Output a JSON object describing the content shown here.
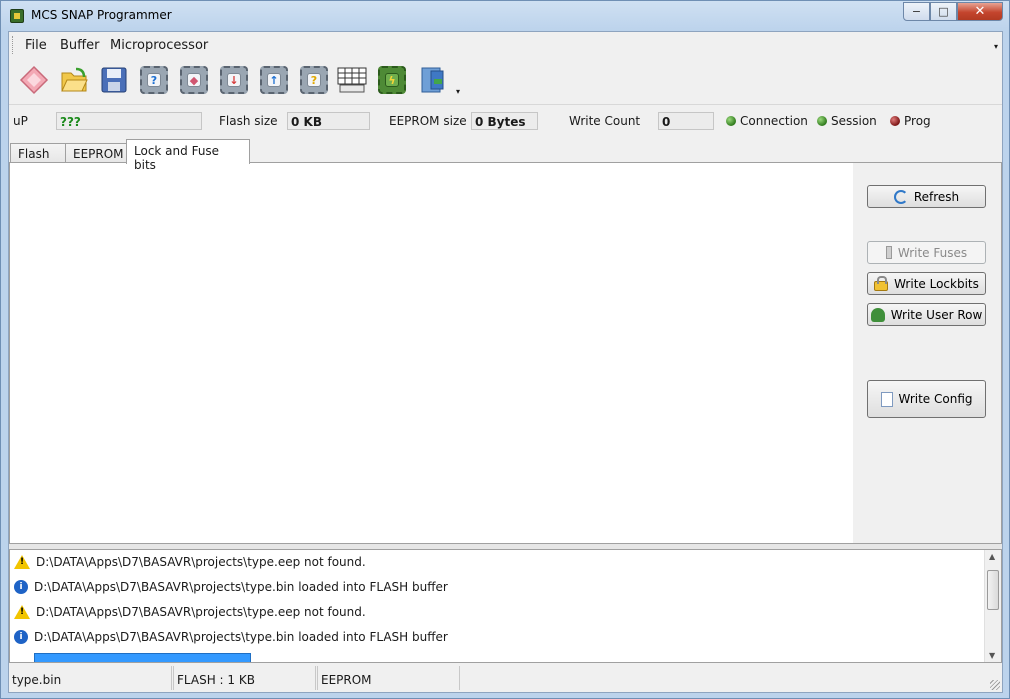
{
  "window": {
    "title": "MCS SNAP Programmer",
    "minimize": "−",
    "maximize": "□",
    "close": "✕"
  },
  "menu": {
    "items": [
      "File",
      "Buffer",
      "Microprocessor"
    ],
    "overflow": "▾"
  },
  "toolbar": {
    "buttons": [
      {
        "name": "erase-chip-icon"
      },
      {
        "name": "open-folder-icon"
      },
      {
        "name": "save-disk-icon"
      },
      {
        "name": "identify-chip-icon",
        "glyph": "?"
      },
      {
        "name": "erase-chip-pink-icon",
        "glyph": "◆"
      },
      {
        "name": "write-chip-icon",
        "glyph": "↓"
      },
      {
        "name": "read-chip-icon",
        "glyph": "↑"
      },
      {
        "name": "verify-chip-icon",
        "glyph": "?"
      },
      {
        "name": "buffer-grid-icon"
      },
      {
        "name": "auto-program-icon",
        "glyph": "ϟ"
      },
      {
        "name": "exit-door-icon"
      }
    ],
    "overflow": "▾"
  },
  "info": {
    "up_label": "uP",
    "up_value": "???",
    "flash_label": "Flash size",
    "flash_value": "0 KB",
    "eeprom_label": "EEPROM size",
    "eeprom_value": "0 Bytes",
    "write_count_label": "Write Count",
    "write_count_value": "0",
    "leds": [
      {
        "label": "Connection",
        "color": "green"
      },
      {
        "label": "Session",
        "color": "green"
      },
      {
        "label": "Prog",
        "color": "red"
      }
    ]
  },
  "tabs": [
    {
      "label": "Flash",
      "active": false
    },
    {
      "label": "EEPROM",
      "active": false
    },
    {
      "label": "Lock and Fuse bits",
      "active": true
    }
  ],
  "buttons": {
    "refresh": "Refresh",
    "write_fuses": "Write Fuses",
    "write_lockbits": "Write Lockbits",
    "write_user_row": "Write User Row",
    "write_config": "Write Config"
  },
  "log": [
    {
      "type": "warning",
      "text": "D:\\DATA\\Apps\\D7\\BASAVR\\projects\\type.eep not found."
    },
    {
      "type": "info",
      "text": "D:\\DATA\\Apps\\D7\\BASAVR\\projects\\type.bin loaded into FLASH buffer"
    },
    {
      "type": "warning",
      "text": "D:\\DATA\\Apps\\D7\\BASAVR\\projects\\type.eep not found."
    },
    {
      "type": "info",
      "text": "D:\\DATA\\Apps\\D7\\BASAVR\\projects\\type.bin loaded into FLASH buffer"
    }
  ],
  "status": {
    "file": "type.bin",
    "flash": "FLASH : 1 KB",
    "eeprom": "EEPROM"
  }
}
